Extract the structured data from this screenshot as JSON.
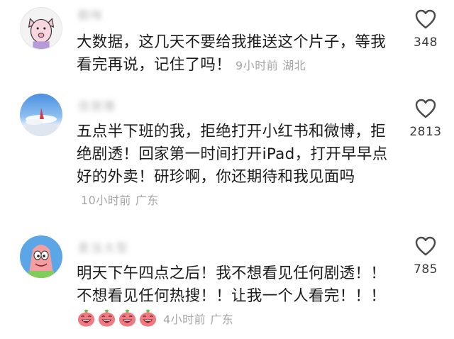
{
  "comments": [
    {
      "username": "鹅咪",
      "text": "大数据，这几天不要给我推送这个片子，等我看完再说，记住了吗！",
      "time": "9小时前",
      "location": "湖北",
      "likes": "348",
      "avatar_icon": "cartoon-pig-avatar"
    },
    {
      "username": "佳丽雅",
      "text": "五点半下班的我，拒绝打开小红书和微博，拒绝剧透！回家第一时间打开iPad，打开早早点好的外卖！研珍啊，你还期待和我见面吗",
      "time": "10小时前",
      "location": "广东",
      "likes": "2813",
      "avatar_icon": "sky-photo-avatar"
    },
    {
      "username": "麦当大型",
      "text": "明天下午四点之后！我不想看见任何剧透！！不想看见任何热搜！！让我一个人看完！！！",
      "time": "4小时前",
      "location": "广东",
      "likes": "785",
      "avatar_icon": "patrick-star-avatar",
      "emoji_icon": "pink-laughing-emoji",
      "emoji_count": 4
    }
  ],
  "colors": {
    "text": "#1b1b1b",
    "meta": "#a6a6a6",
    "count": "#3a3a3a",
    "emoji": "#f07a80"
  }
}
